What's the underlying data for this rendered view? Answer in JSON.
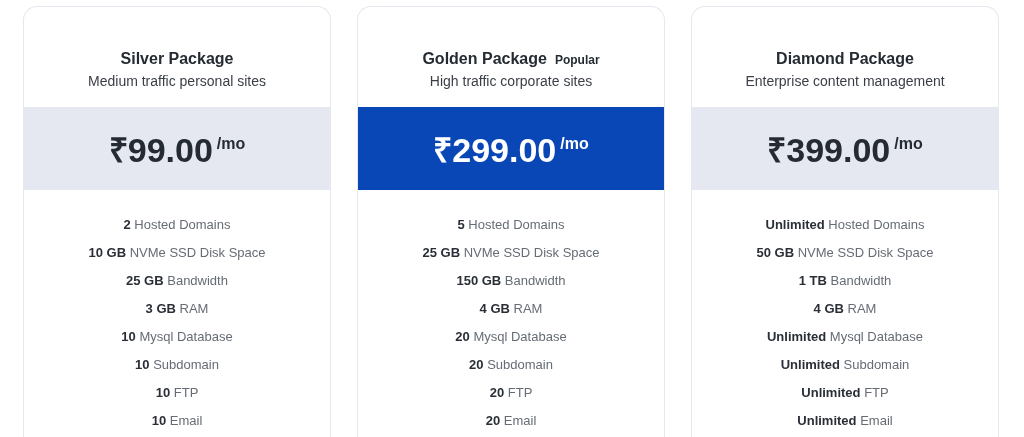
{
  "plans": [
    {
      "name": "Silver Package",
      "featured": false,
      "subtitle": "Medium traffic personal sites",
      "price": "₹99.00",
      "period": "/mo",
      "features": [
        "**2** Hosted Domains",
        "**10 GB** NVMe SSD Disk Space",
        "**25 GB** Bandwidth",
        "**3 GB** RAM",
        "**10** Mysql Database",
        "**10** Subdomain",
        "**10** FTP",
        "**10** Email"
      ]
    },
    {
      "name": "Golden Package",
      "badge": "Popular",
      "featured": true,
      "subtitle": "High traffic corporate sites",
      "price": "₹299.00",
      "period": "/mo",
      "features": [
        "**5** Hosted Domains",
        "**25 GB** NVMe SSD Disk Space",
        "**150 GB** Bandwidth",
        "**4 GB** RAM",
        "**20** Mysql Database",
        "**20** Subdomain",
        "**20** FTP",
        "**20** Email"
      ]
    },
    {
      "name": "Diamond Package",
      "featured": false,
      "subtitle": "Enterprise content management",
      "price": "₹399.00",
      "period": "/mo",
      "features": [
        "**Unlimited** Hosted Domains",
        "**50 GB** NVMe SSD Disk Space",
        "**1 TB** Bandwidth",
        "**4 GB** RAM",
        "**Unlimited** Mysql Database",
        "**Unlimited** Subdomain",
        "**Unlimited** FTP",
        "**Unlimited** Email"
      ]
    }
  ]
}
